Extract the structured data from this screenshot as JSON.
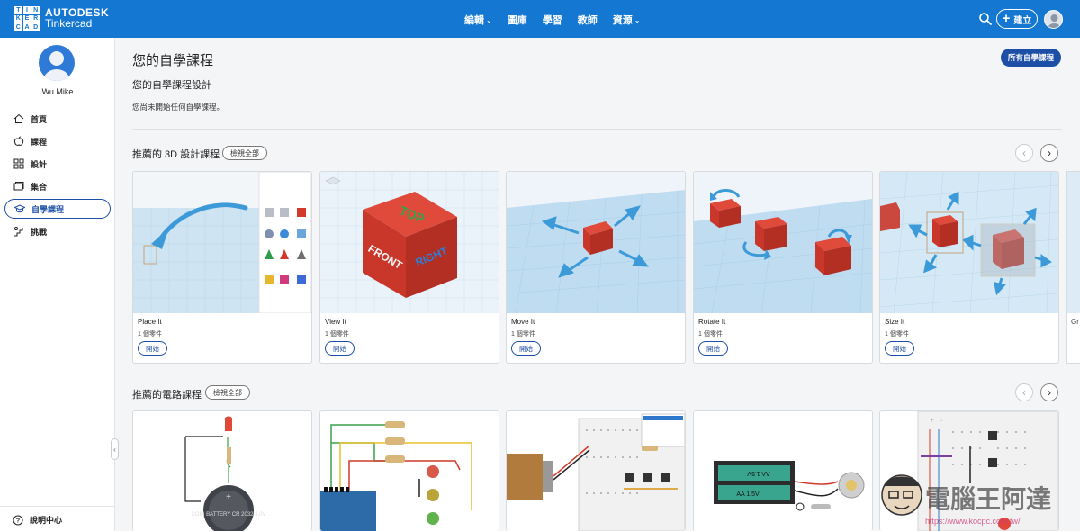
{
  "topbar": {
    "logo_letters": [
      "TIN",
      "KER",
      "CAD"
    ],
    "brand_line1": "AUTODESK",
    "brand_line2": "Tinkercad",
    "nav": [
      {
        "label": "編輯",
        "has_menu": true
      },
      {
        "label": "圖庫",
        "has_menu": false
      },
      {
        "label": "學習",
        "has_menu": false
      },
      {
        "label": "教師",
        "has_menu": false
      },
      {
        "label": "資源",
        "has_menu": true
      }
    ],
    "create_label": "建立",
    "accent": "#1477d1"
  },
  "sidebar": {
    "username": "Wu Mike",
    "items": [
      {
        "label": "首頁",
        "icon": "home-icon",
        "active": false
      },
      {
        "label": "課程",
        "icon": "apple-icon",
        "active": false
      },
      {
        "label": "設計",
        "icon": "grid-icon",
        "active": false
      },
      {
        "label": "集合",
        "icon": "folder-icon",
        "active": false
      },
      {
        "label": "自學課程",
        "icon": "graduation-cap-icon",
        "active": true
      },
      {
        "label": "挑戰",
        "icon": "stairs-icon",
        "active": false
      }
    ],
    "help_label": "說明中心"
  },
  "main": {
    "title": "您的自學課程",
    "all_courses_label": "所有自學課程",
    "subtitle": "您的自學課程設計",
    "empty_note": "您尚未開始任何自學課程。",
    "section_3d": {
      "title": "推薦的 3D 設計課程",
      "view_all": "檢視全部",
      "cards": [
        {
          "title": "Place It",
          "parts": "1 個零件",
          "start": "開始"
        },
        {
          "title": "View It",
          "parts": "1 個零件",
          "start": "開始"
        },
        {
          "title": "Move It",
          "parts": "1 個零件",
          "start": "開始"
        },
        {
          "title": "Rotate It",
          "parts": "1 個零件",
          "start": "開始"
        },
        {
          "title": "Size It",
          "parts": "1 個零件",
          "start": "開始"
        }
      ],
      "peek_label": "Gr"
    },
    "section_circuit": {
      "title": "推薦的電路課程",
      "view_all": "檢視全部"
    },
    "cube_labels": {
      "top": "TOP",
      "front": "FRONT",
      "right": "RIGHT"
    },
    "battery_label": "COIN BATTERY CR 2032 3.0V",
    "battery_aa": "AA 1.5V",
    "watermark": "電腦王阿達",
    "watermark_url": "https://www.kocpc.com.tw/"
  }
}
